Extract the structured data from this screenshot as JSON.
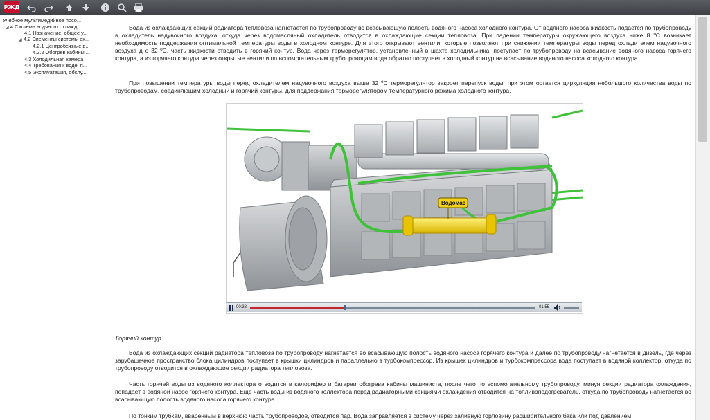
{
  "toolbar": {
    "logo_text": "РЖД",
    "buttons": [
      "undo-icon",
      "redo-icon",
      "up-arrow-icon",
      "down-arrow-icon",
      "info-icon",
      "search-icon",
      "print-icon"
    ]
  },
  "sidebar": {
    "items": [
      {
        "label": "Учебное мультимедийное посо...",
        "level": 0,
        "arrow": ""
      },
      {
        "label": "4 Система водяного охлажд...",
        "level": 1,
        "arrow": "◢"
      },
      {
        "label": "4.1 Назначение, общее у...",
        "level": 2,
        "arrow": ""
      },
      {
        "label": "4.2 Элементы системы ох...",
        "level": 2,
        "arrow": "◢"
      },
      {
        "label": "4.2.1 Центробежные в...",
        "level": 3,
        "arrow": ""
      },
      {
        "label": "4.2.2 Обогрев кабины ...",
        "level": 3,
        "arrow": ""
      },
      {
        "label": "4.3 Холодильная камера",
        "level": 2,
        "arrow": ""
      },
      {
        "label": "4.4 Требования к воде, п...",
        "level": 2,
        "arrow": ""
      },
      {
        "label": "4.5 Эксплуатация, обслу...",
        "level": 2,
        "arrow": ""
      }
    ]
  },
  "content": {
    "p1": "Вода из охлаждающих секций радиатора тепловоза нагнетается по трубопроводу во всасывающую полость водяного насоса холодного контура. От водяного насоса жидкость подается по трубопроводу в охладитель надувочного воздуха, откуда через водомасляный охладитель отводится в охлаждающие секции тепловоза. При падении температуры окружающего воздуха ниже 8 ºС возникает необходимость поддержания оптимальной температуры воды в холодном контуре. Для этого открывают вентили, которые позволяют при снижении температуры воды перед охладителем надувочного воздуха д о 32 ºС, часть жидкости отводить в горячий контур. Вода через терморегулятор, установленный в шахте холодильника, поступает по трубопроводу на всасывание водяного насоса горячего контура, а из горячего контура через открытые вентили по вспомогательным трубопроводам вода обратно поступает в холодный контур на всасывание водяного насоса холодного контура.",
    "p2": "При повышении температуры воды перед охладителем надувочного воздуха выше 32 ºС терморегулятор закроет перепуск воды, при этом остается циркуляция небольшого количества воды по трубопроводам, соединяющим холодный и горячий контуры, для поддержания терморегулятором температурного режима холодного контура.",
    "heading": "Горячий контур.",
    "p3": "Вода из охлаждающих секций радиатора тепловоза по трубопроводу нагнетается во всасывающую полость водяного насоса горячего контура и далее по трубопроводу нагнетается в дизель, где через зарубашечное пространство блока цилиндров поступает в крышки цилиндров и параллельно в турбокомпрессор. Из крышек цилиндров и турбокомпрессора вода поступает в водяной коллектор, откуда по трубопроводу отводится в охлаждающие секции радиатора тепловоза.",
    "p4": "Часть горячей воды из водяного коллектора отводится в калорифер и батареи обогрева кабины машиниста, после чего по вспомогательному трубопроводу, минуя секции радиатора охлаждения, попадает в водяной насос горячего контура. Ещё часть воды из водяного коллектора перед радиаторными секциями охлаждения отводится на топливоподогреватель, откуда по трубопроводу нагнетается во всасывающую полость водяного насоса горячего контура.",
    "p5": "По тонким трубкам, вваренным в верхнюю часть трубопроводов, отводится пар. Вода заправляется в систему через заливную горловину расширительного бака или под давлением"
  },
  "video": {
    "callout_label": "Водомас",
    "time_current": "00:38",
    "time_total": "01:55",
    "progress": 0.33,
    "colors": {
      "pipe": "#3fc13a",
      "cooler": "#f2d21a",
      "engine": "#bfc2c5",
      "progress": "#c1272d"
    }
  }
}
